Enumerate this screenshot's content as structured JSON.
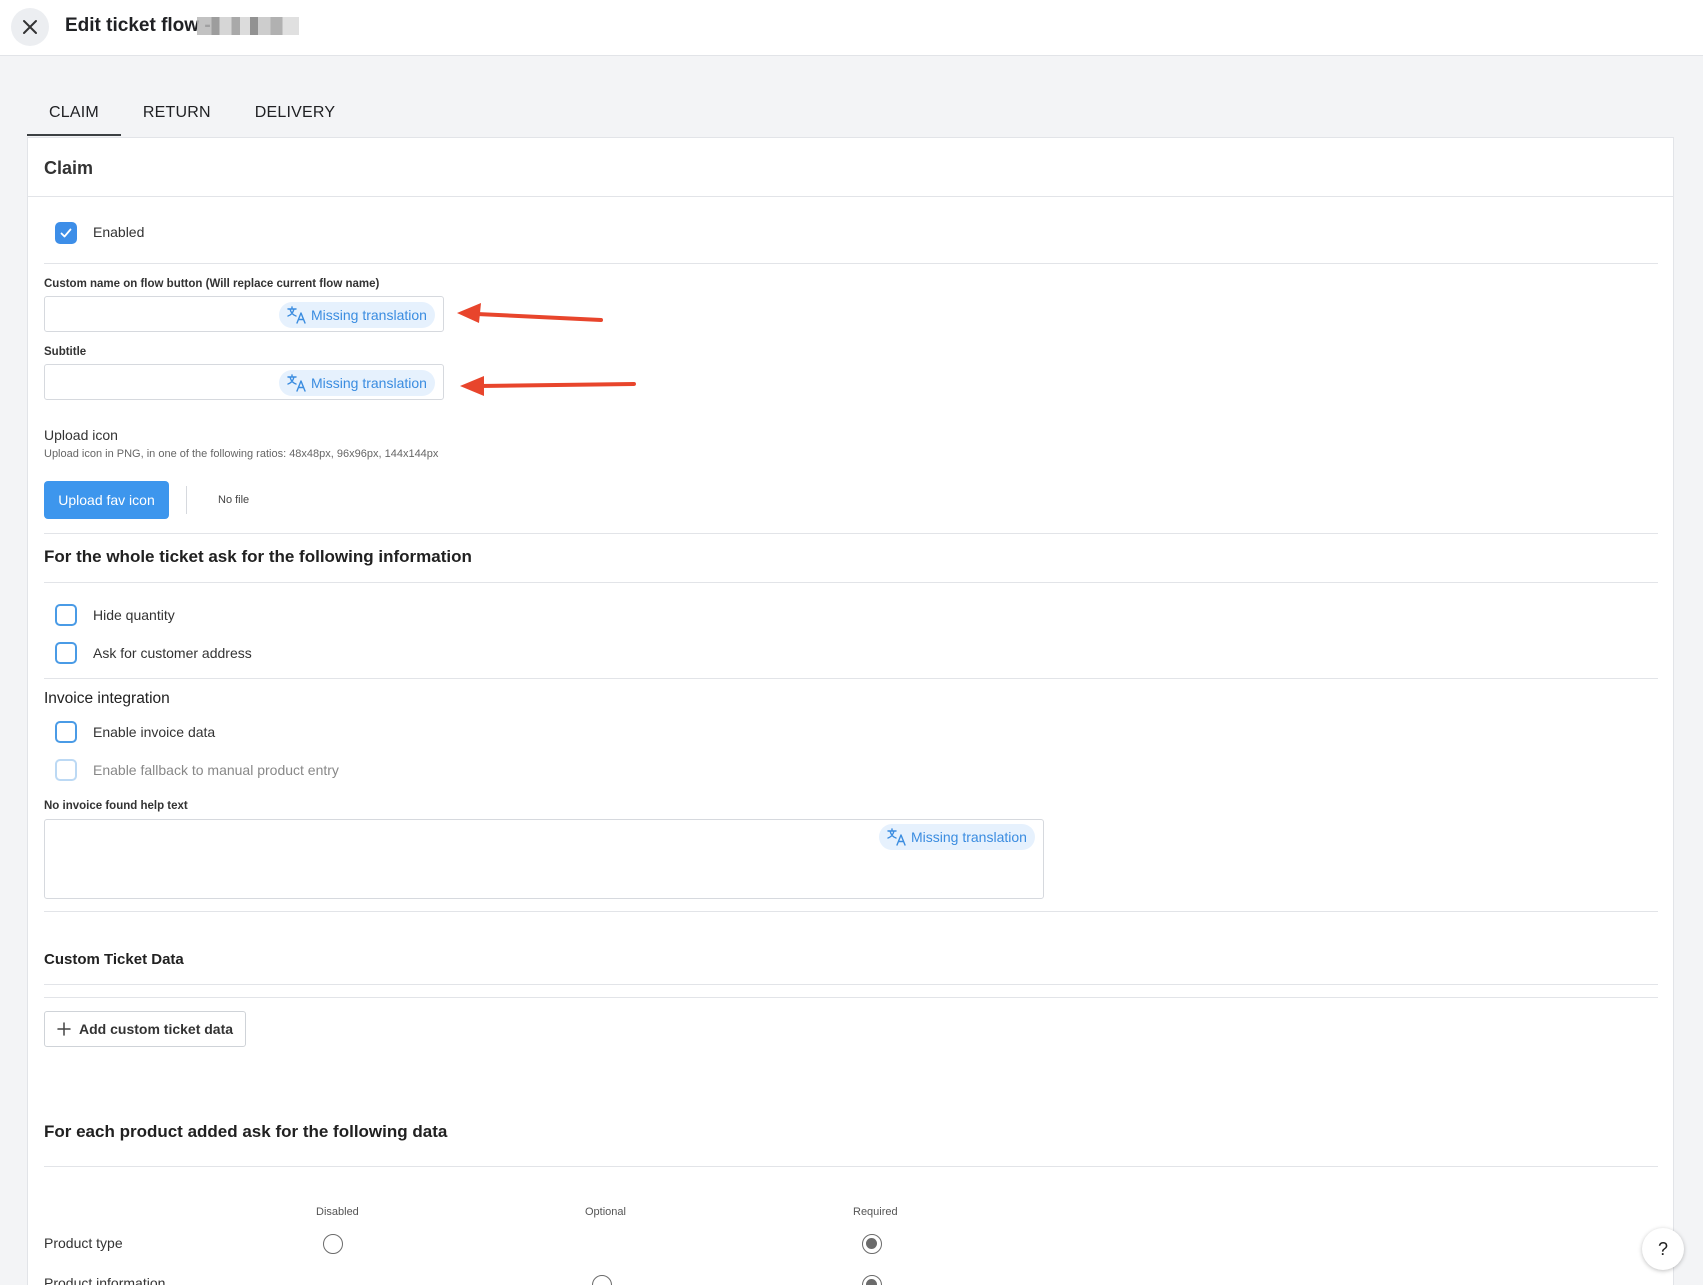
{
  "header": {
    "title": "Edit ticket flow -"
  },
  "tabs": [
    {
      "label": "CLAIM"
    },
    {
      "label": "RETURN"
    },
    {
      "label": "DELIVERY"
    }
  ],
  "card": {
    "title": "Claim",
    "enabled_label": "Enabled",
    "custom_name": {
      "label": "Custom name on flow button (Will replace current flow name)",
      "value": "",
      "missing_translation": "Missing translation"
    },
    "subtitle": {
      "label": "Subtitle",
      "value": "",
      "missing_translation": "Missing translation"
    },
    "upload": {
      "title": "Upload icon",
      "hint": "Upload icon in PNG, in one of the following ratios: 48x48px, 96x96px, 144x144px",
      "button_label": "Upload fav icon",
      "file_status": "No file"
    },
    "whole_ticket": {
      "title": "For the whole ticket ask for the following information",
      "options": [
        {
          "label": "Hide quantity",
          "checked": false
        },
        {
          "label": "Ask for customer address",
          "checked": false
        }
      ]
    },
    "invoice": {
      "title": "Invoice integration",
      "enable_label": "Enable invoice data",
      "fallback_label": "Enable fallback to manual product entry",
      "help_text_label": "No invoice found help text",
      "help_text_value": "",
      "missing_translation": "Missing translation"
    },
    "custom_data": {
      "title": "Custom Ticket Data",
      "add_button": "Add custom ticket data"
    },
    "per_product": {
      "title": "For each product added ask for the following data",
      "columns": [
        "Disabled",
        "Optional",
        "Required"
      ],
      "rows": [
        {
          "label": "Product type",
          "selected": "Required"
        },
        {
          "label": "Product information",
          "selected": "Required"
        }
      ]
    }
  },
  "help_button": "?",
  "colors": {
    "accent": "#3d96ed",
    "chip_bg": "#e6f1fd",
    "chip_text": "#3a8ce0",
    "annotation_arrow": "#e8452c"
  }
}
